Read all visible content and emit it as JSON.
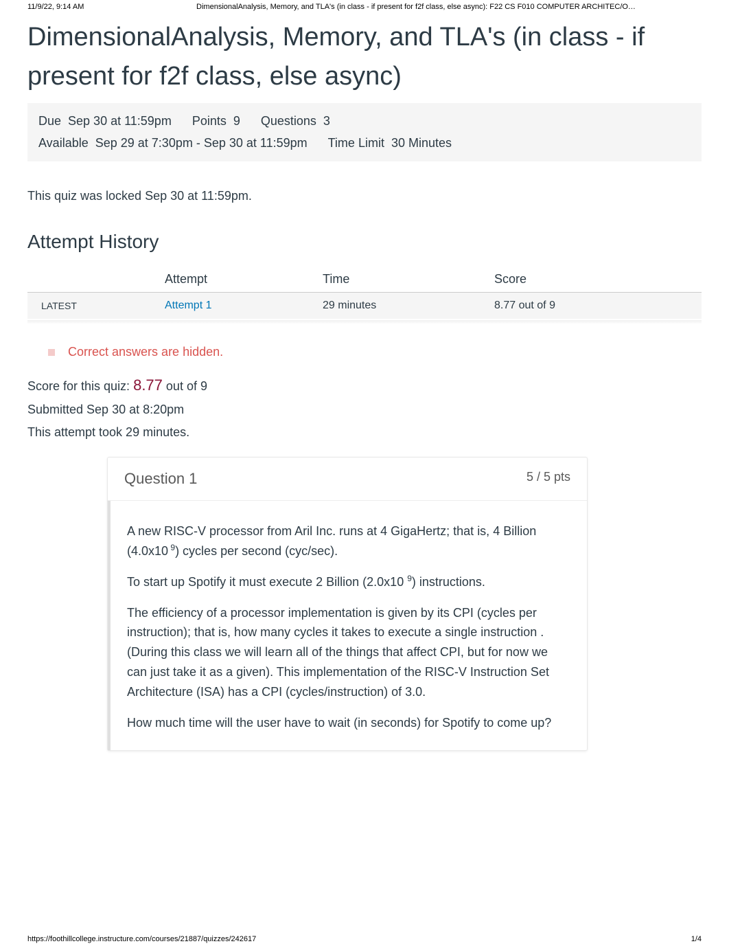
{
  "header": {
    "timestamp": "11/9/22, 9:14 AM",
    "doc_title": "DimensionalAnalysis, Memory, and TLA's (in class - if present for f2f class, else async): F22 CS F010 COMPUTER ARCHITEC/O…"
  },
  "page_title": "DimensionalAnalysis, Memory, and TLA's (in class - if present for f2f class, else async)",
  "meta": {
    "due_label": "Due",
    "due_value": "Sep 30 at 11:59pm",
    "points_label": "Points",
    "points_value": "9",
    "questions_label": "Questions",
    "questions_value": "3",
    "available_label": "Available",
    "available_value": "Sep 29 at 7:30pm - Sep 30 at 11:59pm",
    "timelimit_label": "Time Limit",
    "timelimit_value": "30 Minutes"
  },
  "locked_msg": "This quiz was locked Sep 30 at 11:59pm.",
  "attempt_history": {
    "title": "Attempt History",
    "cols": {
      "blank": "",
      "attempt": "Attempt",
      "time": "Time",
      "score": "Score"
    },
    "rows": [
      {
        "tag": "LATEST",
        "attempt_link": "Attempt 1",
        "time": "29 minutes",
        "score": "8.77 out of 9"
      }
    ]
  },
  "correct_hidden": "Correct answers are hidden.",
  "quiz_meta": {
    "score_prefix": "Score for this quiz: ",
    "score_value": "8.77",
    "score_suffix": " out of 9",
    "submitted": "Submitted Sep 30 at 8:20pm",
    "duration": "This attempt took 29 minutes."
  },
  "question1": {
    "title": "Question 1",
    "pts": "5 / 5 pts",
    "p1a": "A new RISC-V processor from Aril Inc. runs at 4 GigaHertz; that is, 4 Billion (4.0x10",
    "p1sup": " 9",
    "p1b": ") cycles per second (cyc/sec).",
    "p2a": "To start up Spotify it must execute 2 Billion (2.0x10 ",
    "p2sup": "9",
    "p2b": ") instructions.",
    "p3": "The  efficiency    of a processor implementation is given by its       CPI  (cycles per instruction); that is, how many      cycles   it takes to execute a single instruction   . (During this class we will learn all of the things that affect CPI, but for now we can just take it as a given). This implementation of the RISC-V Instruction Set Architecture (ISA) has a CPI (cycles/instruction) of 3.0.",
    "p4": "How much time will the user have to wait (in seconds) for Spotify to come up?"
  },
  "footer": {
    "url": "https://foothillcollege.instructure.com/courses/21887/quizzes/242617",
    "page": "1/4"
  }
}
